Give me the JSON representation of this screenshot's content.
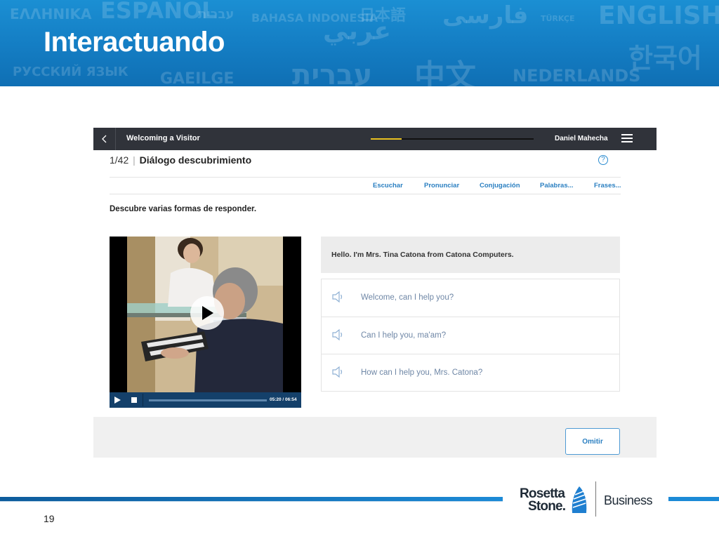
{
  "slide": {
    "title": "Interactuando",
    "page_number": "19",
    "background_words": [
      "ΕΛΛΗΝΙΚΑ",
      "ESPAÑOL",
      "עברית",
      "BAHASA INDONESIA",
      "日本語",
      "فارسی",
      "TÜRKÇE",
      "ENGLISH",
      "한국어",
      "РУССКИЙ ЯЗЫК",
      "GAEILGE",
      "עברית",
      "中文",
      "NEDERLANDS",
      "عربي"
    ]
  },
  "app": {
    "lesson_title": "Welcoming a Visitor",
    "progress": 0.19,
    "user_name": "Daniel Mahecha",
    "activity_count": "1/42",
    "activity_separator": "|",
    "activity_name": "Diálogo descubrimiento",
    "help_label": "?",
    "tabs": [
      "Escuchar",
      "Pronunciar",
      "Conjugación",
      "Palabras...",
      "Frases..."
    ],
    "instruction": "Descubre varias formas de responder.",
    "video": {
      "time": "05:20 / 06:54",
      "progress": 0
    },
    "prompt": "Hello. I'm Mrs. Tina Catona from Catona Computers.",
    "options": [
      {
        "text": "Welcome, can I help you?"
      },
      {
        "text": "Can I help you, ma'am?"
      },
      {
        "text": "How can I help you, Mrs. Catona?"
      }
    ],
    "omit_label": "Omitir"
  },
  "brand": {
    "logo_line1": "Rosetta",
    "logo_line2": "Stone.",
    "logo_business": "Business"
  },
  "colors": {
    "banner": "#1580c6",
    "topbar": "#30333a",
    "progress": "#e8c020",
    "link": "#2a7fc1",
    "option_text": "#6f87a6"
  }
}
